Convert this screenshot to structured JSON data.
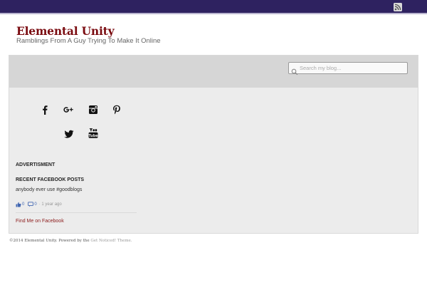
{
  "header": {
    "rss_icon": "rss-icon",
    "site_title": "Elemental Unity",
    "tagline": "Ramblings From A Guy Trying To Make It Online"
  },
  "search": {
    "placeholder": "Search my blog..."
  },
  "social_icons": [
    "facebook-icon",
    "google-plus-icon",
    "instagram-icon",
    "pinterest-icon",
    "twitter-icon",
    "youtube-icon"
  ],
  "widgets": {
    "advertisment_heading": "ADVERTISMENT",
    "facebook_heading": "RECENT FACEBOOK POSTS",
    "post": {
      "text": "anybody ever use #goodblogs",
      "likes": "0",
      "comments": "0",
      "time": "· 1 year ago"
    },
    "find_me_link": "Find Me on Facebook"
  },
  "footer": {
    "copyright": "©2014 Elemental Unity. Powered by the",
    "theme_link": "Get Noticed! Theme."
  },
  "colors": {
    "topbar": "#2e2260",
    "title": "#7a0b10",
    "panel": "#ececec",
    "search_band": "#d6d6d6",
    "link": "#8b1a1a",
    "facebook_blue": "#4267b2"
  }
}
